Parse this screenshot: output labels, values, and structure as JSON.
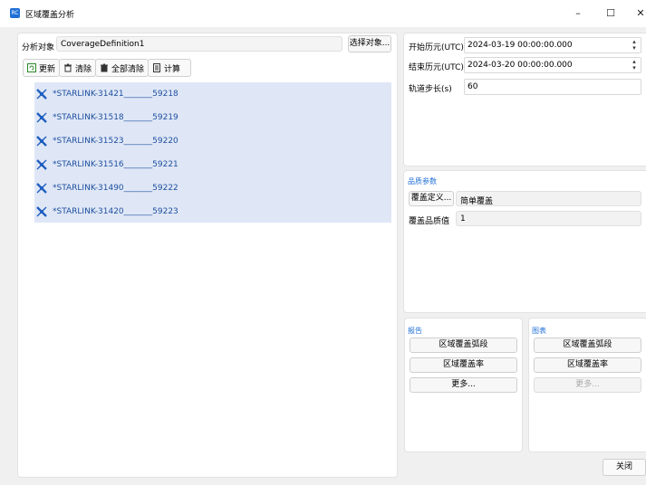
{
  "window": {
    "title": "区域覆盖分析",
    "icon_label": "RC",
    "minimize_glyph": "–",
    "maximize_glyph": "☐",
    "close_glyph": "✕"
  },
  "left": {
    "target_label": "分析对象",
    "target_value": "CoverageDefinition1",
    "select_button": "选择对象...",
    "toolbar": {
      "refresh": "更新",
      "clear": "清除",
      "clear_all": "全部清除",
      "compute": "计算"
    },
    "items": [
      "*STARLINK-31421_______59218",
      "*STARLINK-31518_______59219",
      "*STARLINK-31523_______59220",
      "*STARLINK-31516_______59221",
      "*STARLINK-31490_______59222",
      "*STARLINK-31420_______59223"
    ]
  },
  "time": {
    "start_label": "开始历元(UTC)",
    "start_value": "2024-03-19 00:00:00.000",
    "end_label": "结束历元(UTC)",
    "end_value": "2024-03-20 00:00:00.000",
    "step_label": "轨道步长(s)",
    "step_value": "60"
  },
  "quality": {
    "section_title": "品质参数",
    "define_button": "覆盖定义...",
    "define_value": "简单覆盖",
    "quality_label": "覆盖品质值",
    "quality_value": "1"
  },
  "report": {
    "title": "报告",
    "buttons": [
      "区域覆盖弧段",
      "区域覆盖率",
      "更多..."
    ]
  },
  "chart": {
    "title": "图表",
    "buttons": [
      "区域覆盖弧段",
      "区域覆盖率",
      "更多..."
    ]
  },
  "close_button": "关闭"
}
